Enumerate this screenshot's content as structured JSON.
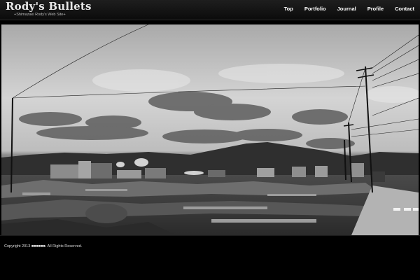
{
  "site": {
    "title": "Rody's Bullets",
    "tagline": "+Shimazaki Rody's Web Site+"
  },
  "nav": [
    {
      "label": "Top"
    },
    {
      "label": "Portfolio"
    },
    {
      "label": "Journal"
    },
    {
      "label": "Profile"
    },
    {
      "label": "Contact"
    }
  ],
  "footer": {
    "copyright": "Copyright 2013 ■■■■■■. All Rights Reserved."
  }
}
